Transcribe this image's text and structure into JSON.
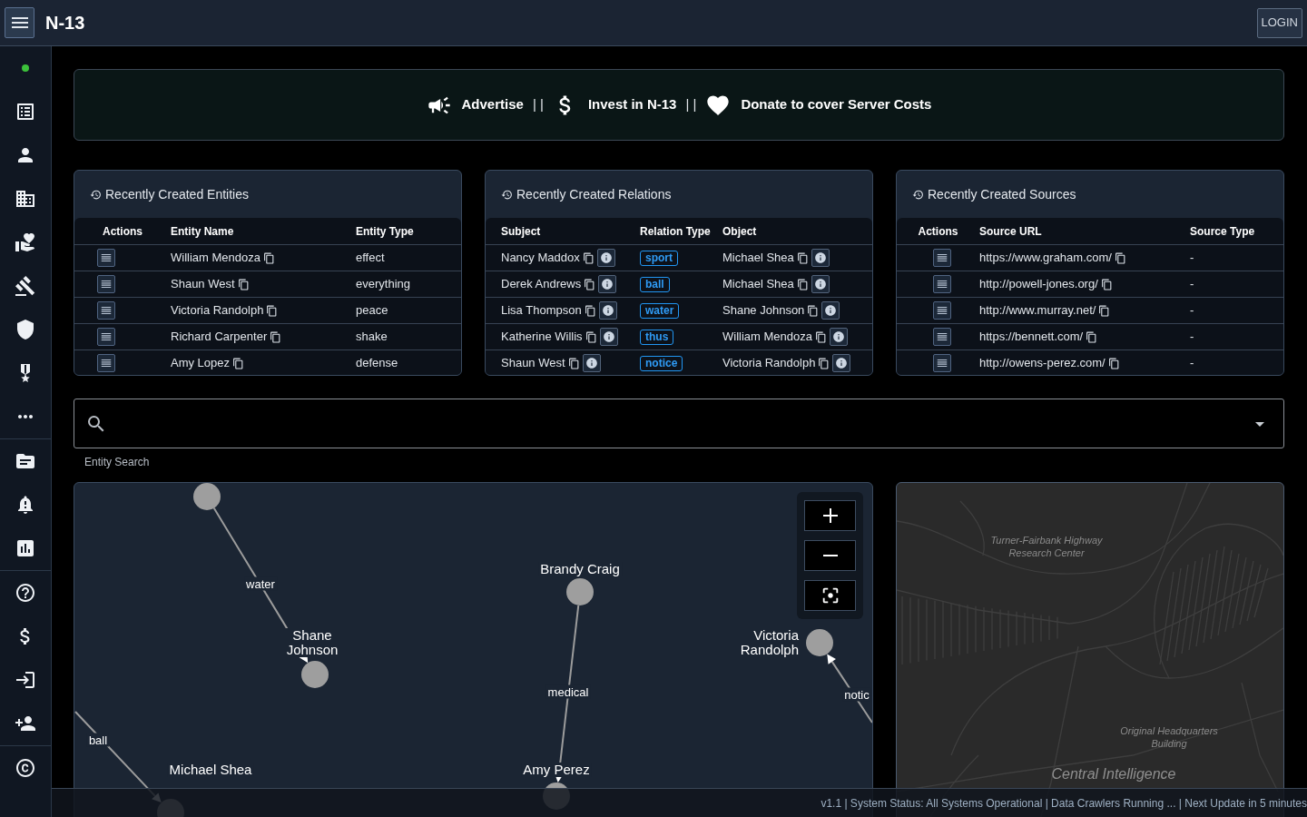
{
  "header": {
    "title": "N-13",
    "login_label": "LOGIN"
  },
  "banner": {
    "items": [
      {
        "kind": "link",
        "label": "Advertise"
      },
      {
        "kind": "separator",
        "label": "| |"
      },
      {
        "kind": "link",
        "label": "Invest in N-13"
      },
      {
        "kind": "separator",
        "label": "| |"
      },
      {
        "kind": "link",
        "label": "Donate to cover Server Costs"
      }
    ]
  },
  "entities": {
    "title": "Recently Created Entities",
    "columns": [
      "Actions",
      "Entity Name",
      "Entity Type"
    ],
    "rows": [
      {
        "name": "William Mendoza",
        "type": "effect"
      },
      {
        "name": "Shaun West",
        "type": "everything"
      },
      {
        "name": "Victoria Randolph",
        "type": "peace"
      },
      {
        "name": "Richard Carpenter",
        "type": "shake"
      },
      {
        "name": "Amy Lopez",
        "type": "defense"
      }
    ]
  },
  "relations": {
    "title": "Recently Created Relations",
    "columns": [
      "Subject",
      "Relation Type",
      "Object"
    ],
    "rows": [
      {
        "subject": "Nancy Maddox",
        "relation": "sport",
        "object": "Michael Shea"
      },
      {
        "subject": "Derek Andrews",
        "relation": "ball",
        "object": "Michael Shea"
      },
      {
        "subject": "Lisa Thompson",
        "relation": "water",
        "object": "Shane Johnson"
      },
      {
        "subject": "Katherine Willis",
        "relation": "thus",
        "object": "William Mendoza"
      },
      {
        "subject": "Shaun West",
        "relation": "notice",
        "object": "Victoria Randolph"
      }
    ]
  },
  "sources": {
    "title": "Recently Created Sources",
    "columns": [
      "Actions",
      "Source URL",
      "Source Type"
    ],
    "rows": [
      {
        "url": "https://www.graham.com/",
        "type": "-"
      },
      {
        "url": "http://powell-jones.org/",
        "type": "-"
      },
      {
        "url": "http://www.murray.net/",
        "type": "-"
      },
      {
        "url": "https://bennett.com/",
        "type": "-"
      },
      {
        "url": "http://owens-perez.com/",
        "type": "-"
      }
    ]
  },
  "search": {
    "helper_text": "Entity Search"
  },
  "graph": {
    "nodes": [
      {
        "label": "Brandy Craig"
      },
      {
        "label": "Shane Johnson"
      },
      {
        "label": "Victoria Randolph"
      },
      {
        "label": "Michael Shea"
      },
      {
        "label": "Amy Perez"
      }
    ],
    "edges": [
      {
        "label": "water"
      },
      {
        "label": "medical"
      },
      {
        "label": "notic"
      },
      {
        "label": "ball"
      }
    ]
  },
  "map": {
    "labels": [
      {
        "text": "Turner-Fairbank Highway Research Center",
        "kind": "small"
      },
      {
        "text": "Original Headquarters Building",
        "kind": "small"
      },
      {
        "text": "Central Intelligence",
        "kind": "large"
      }
    ]
  },
  "status_bar": {
    "text": "v1.1 | System Status: All Systems Operational | Data Crawlers Running ... | Next Update in 5 minutes"
  }
}
